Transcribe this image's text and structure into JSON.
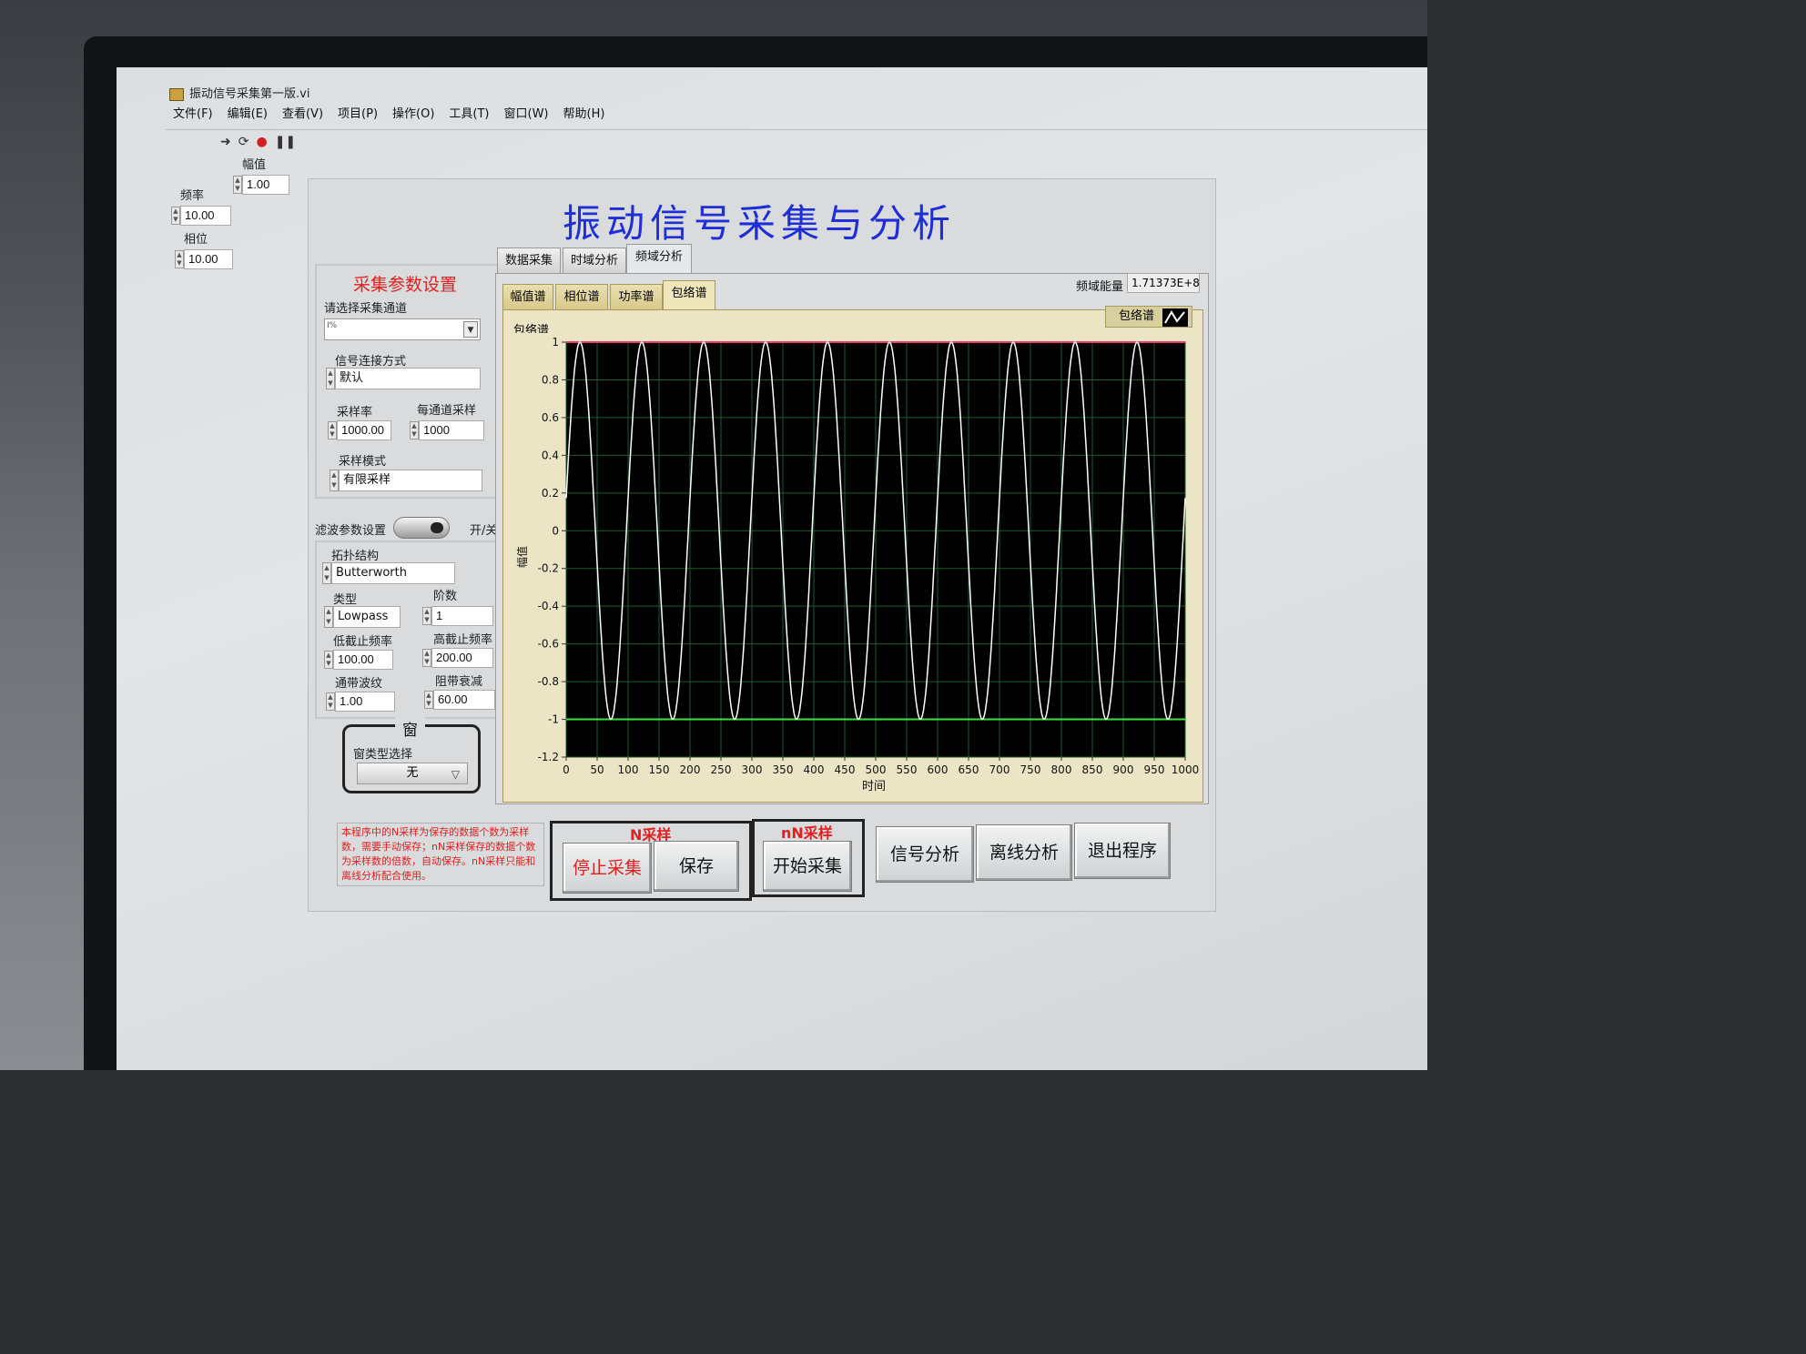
{
  "window": {
    "title": "振动信号采集第一版.vi"
  },
  "menu": [
    "文件(F)",
    "编辑(E)",
    "查看(V)",
    "项目(P)",
    "操作(O)",
    "工具(T)",
    "窗口(W)",
    "帮助(H)"
  ],
  "toolbar": {
    "run": "➜",
    "run_continuous": "⟳",
    "abort": "●",
    "pause": "❚❚"
  },
  "sim_controls": {
    "amplitude": {
      "label": "幅值",
      "value": "1.00"
    },
    "frequency": {
      "label": "频率",
      "value": "10.00"
    },
    "phase": {
      "label": "相位",
      "value": "10.00"
    }
  },
  "title": "振动信号采集与分析",
  "acquisition": {
    "heading": "采集参数设置",
    "channel_label": "请选择采集通道",
    "channel_value": "",
    "channel_prefix": "I%",
    "connection_label": "信号连接方式",
    "connection_value": "默认",
    "rate_label": "采样率",
    "rate_value": "1000.00",
    "samples_label": "每通道采样",
    "samples_value": "1000",
    "mode_label": "采样模式",
    "mode_value": "有限采样"
  },
  "filter": {
    "heading": "滤波参数设置",
    "toggle_label": "开/关",
    "topology_label": "拓扑结构",
    "topology_value": "Butterworth",
    "type_label": "类型",
    "type_value": "Lowpass",
    "order_label": "阶数",
    "order_value": "1",
    "low_cutoff_label": "低截止频率",
    "low_cutoff_value": "100.00",
    "high_cutoff_label": "高截止频率",
    "high_cutoff_value": "200.00",
    "passband_label": "通带波纹",
    "passband_value": "1.00",
    "stopband_label": "阻带衰减",
    "stopband_value": "60.00"
  },
  "window_section": {
    "heading": "窗",
    "type_label": "窗类型选择",
    "type_value": "无"
  },
  "tabs": [
    "数据采集",
    "时域分析",
    "频域分析"
  ],
  "selected_tab": "频域分析",
  "subtabs": [
    "幅值谱",
    "相位谱",
    "功率谱",
    "包络谱"
  ],
  "selected_subtab": "包络谱",
  "energy": {
    "label": "频域能量",
    "value": "1.71373E+8"
  },
  "graph": {
    "label": "包络谱",
    "legend": "包络谱"
  },
  "chart_data": {
    "type": "line",
    "title": "",
    "xlabel": "时间",
    "ylabel": "幅值",
    "xlim": [
      0,
      1000
    ],
    "ylim": [
      -1.2,
      1
    ],
    "xticks": [
      "0",
      "50",
      "100",
      "150",
      "200",
      "250",
      "300",
      "350",
      "400",
      "450",
      "500",
      "550",
      "600",
      "650",
      "700",
      "750",
      "800",
      "850",
      "900",
      "950",
      "1000"
    ],
    "yticks": [
      "1",
      "0.8",
      "0.6",
      "0.4",
      "0.2",
      "0",
      "-0.2",
      "-0.4",
      "-0.6",
      "-0.8",
      "-1",
      "-1.2"
    ],
    "series": [
      {
        "name": "包络谱",
        "function": "sine",
        "amplitude": 1,
        "frequency_per_1000": 10,
        "phase_deg": 10,
        "color": "#ffffff"
      }
    ],
    "upper_line": {
      "y": 1,
      "color": "#e0406a"
    },
    "lower_line": {
      "y": -1,
      "color": "#40e040"
    },
    "background": "#000000",
    "grid": true,
    "grid_color": "#1e5a2a"
  },
  "note": "本程序中的N采样为保存的数据个数为采样数，需要手动保存；nN采样保存的数据个数为采样数的倍数，自动保存。nN采样只能和离线分析配合使用。",
  "n_group": {
    "title": "N采样",
    "stop": "停止采集",
    "save": "保存"
  },
  "nn_group": {
    "title": "nN采样",
    "start": "开始采集"
  },
  "actions": {
    "signal_analysis": "信号分析",
    "offline_analysis": "离线分析",
    "exit": "退出程序"
  }
}
